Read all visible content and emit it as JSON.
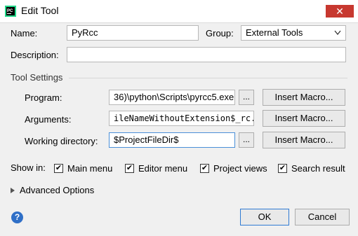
{
  "window": {
    "title": "Edit Tool",
    "close_glyph": "✕"
  },
  "form": {
    "name_label": "Name:",
    "name_value": "PyRcc",
    "group_label": "Group:",
    "group_value": "External Tools",
    "description_label": "Description:",
    "description_value": ""
  },
  "tool_settings": {
    "section_label": "Tool Settings",
    "program_label": "Program:",
    "program_value": "36)\\python\\Scripts\\pyrcc5.exe",
    "arguments_label": "Arguments:",
    "arguments_value": "ileNameWithoutExtension$_rc.py",
    "working_dir_label": "Working directory:",
    "working_dir_value": "$ProjectFileDir$",
    "browse_label": "...",
    "insert_macro_label": "Insert Macro..."
  },
  "show_in": {
    "label": "Show in:",
    "options": [
      {
        "label": "Main menu",
        "checked": true
      },
      {
        "label": "Editor menu",
        "checked": true
      },
      {
        "label": "Project views",
        "checked": true
      },
      {
        "label": "Search result",
        "checked": true
      }
    ]
  },
  "advanced": {
    "label": "Advanced Options"
  },
  "footer": {
    "help_glyph": "?",
    "ok_label": "OK",
    "cancel_label": "Cancel"
  },
  "colors": {
    "accent": "#2f7ad3",
    "close": "#c7382f",
    "help": "#2f6fc7"
  }
}
